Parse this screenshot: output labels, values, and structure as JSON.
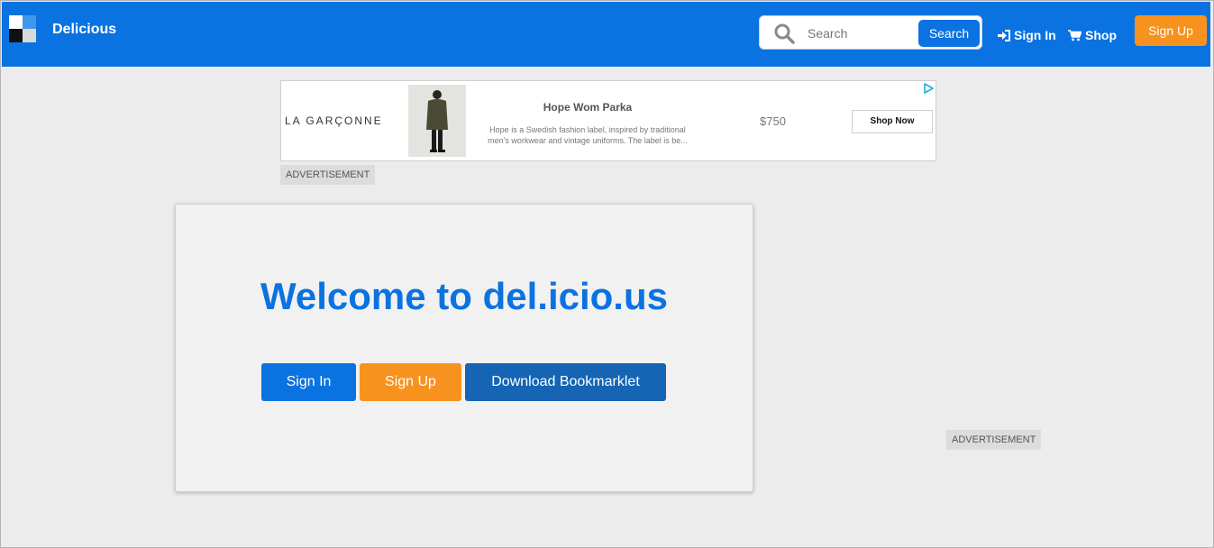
{
  "header": {
    "brand": "Delicious",
    "search_placeholder": "Search",
    "search_button": "Search",
    "sign_in": "Sign In",
    "shop": "Shop",
    "sign_up": "Sign Up"
  },
  "ad": {
    "brand": "LA GARÇONNE",
    "title": "Hope Wom Parka",
    "description": "Hope is a Swedish fashion label, inspired by traditional men's workwear and vintage uniforms. The label is be...",
    "price": "$750",
    "cta": "Shop Now",
    "label": "ADVERTISEMENT"
  },
  "side_ad": {
    "label": "ADVERTISEMENT"
  },
  "welcome": {
    "title": "Welcome to del.icio.us",
    "sign_in": "Sign In",
    "sign_up": "Sign Up",
    "bookmarklet": "Download Bookmarklet"
  },
  "colors": {
    "primary": "#0a73e1",
    "accent": "#f8921e",
    "dark_blue": "#1565b4",
    "page_bg": "#ececec"
  }
}
